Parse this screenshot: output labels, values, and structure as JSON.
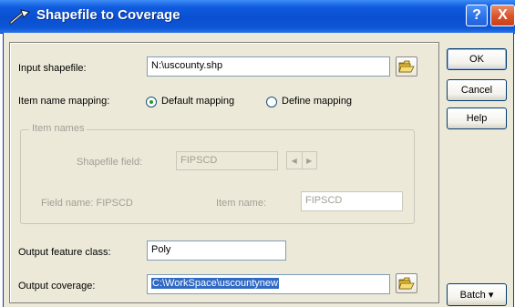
{
  "window": {
    "title": "Shapefile to Coverage",
    "help_button": "?",
    "close_button": "X"
  },
  "input_shapefile": {
    "label": "Input shapefile:",
    "value": "N:\\uscounty.shp"
  },
  "item_name_mapping": {
    "label": "Item name mapping:",
    "default_label": "Default mapping",
    "define_label": "Define mapping",
    "selected": "Default mapping"
  },
  "item_names": {
    "group_title": "Item names",
    "shapefile_field_label": "Shapefile field:",
    "shapefile_field_value": "FIPSCD",
    "field_name_label": "Field name: FIPSCD",
    "item_name_label": "Item name:",
    "item_name_value": "FIPSCD",
    "spin_left": "◀",
    "spin_right": "▶"
  },
  "output_feature_class": {
    "label": "Output feature class:",
    "value": "Poly"
  },
  "output_coverage": {
    "label": "Output coverage:",
    "value": "C:\\WorkSpace\\uscountynew"
  },
  "buttons": {
    "ok": "OK",
    "cancel": "Cancel",
    "help": "Help",
    "batch": "Batch ▾"
  },
  "colors": {
    "titlebar": "#0a4fd0",
    "dialog_bg": "#ece9d8",
    "selection": "#316ac5",
    "disabled_text": "#a09f96"
  },
  "icons": {
    "title": "wrench-arrow-icon",
    "browse": "open-folder-icon"
  }
}
